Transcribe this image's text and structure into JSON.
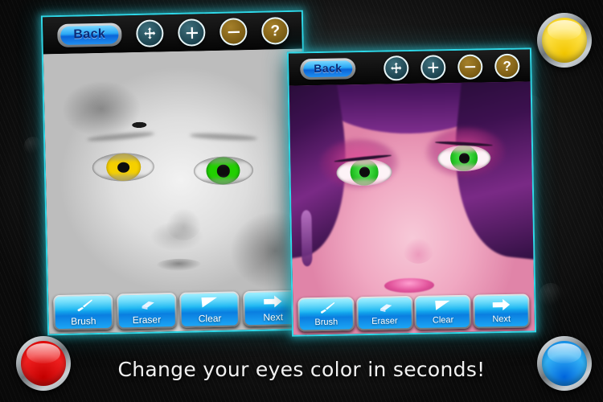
{
  "app": {
    "tagline": "Change your eyes color in seconds!"
  },
  "panels": [
    {
      "id": "baby",
      "subject": "grayscale baby photo with recolored eyes",
      "topbar": {
        "back_label": "Back",
        "icons": [
          {
            "name": "move-icon",
            "glyph": "move",
            "color": "#2a5a68"
          },
          {
            "name": "zoom-in-icon",
            "glyph": "plus",
            "color": "#2a5a68"
          },
          {
            "name": "zoom-out-icon",
            "glyph": "minus",
            "color": "#7b5c14"
          },
          {
            "name": "help-icon",
            "glyph": "?",
            "color": "#7b5c14"
          }
        ]
      },
      "eyes": {
        "left_color": "#f5d000",
        "right_color": "#22d000"
      },
      "toolbar": [
        {
          "name": "brush",
          "label": "Brush",
          "icon": "brush-icon"
        },
        {
          "name": "eraser",
          "label": "Eraser",
          "icon": "eraser-icon"
        },
        {
          "name": "clear",
          "label": "Clear",
          "icon": "clear-icon"
        },
        {
          "name": "next",
          "label": "Next",
          "icon": "arrow-right-icon"
        }
      ]
    },
    {
      "id": "woman",
      "subject": "pink toned portrait with green eyes",
      "topbar": {
        "back_label": "Back",
        "icons": [
          {
            "name": "move-icon",
            "glyph": "move",
            "color": "#2a5a68"
          },
          {
            "name": "zoom-in-icon",
            "glyph": "plus",
            "color": "#2a5a68"
          },
          {
            "name": "zoom-out-icon",
            "glyph": "minus",
            "color": "#7b5c14"
          },
          {
            "name": "help-icon",
            "glyph": "?",
            "color": "#7b5c14"
          }
        ]
      },
      "eyes": {
        "left_color": "#1fbf1f",
        "right_color": "#1fbf1f"
      },
      "toolbar": [
        {
          "name": "brush",
          "label": "Brush",
          "icon": "brush-icon"
        },
        {
          "name": "eraser",
          "label": "Eraser",
          "icon": "eraser-icon"
        },
        {
          "name": "clear",
          "label": "Clear",
          "icon": "clear-icon"
        },
        {
          "name": "next",
          "label": "Next",
          "icon": "arrow-right-icon"
        }
      ]
    }
  ],
  "corner_buttons": [
    {
      "name": "lamp-yellow",
      "color": "#ffd400",
      "position": "top-right"
    },
    {
      "name": "lamp-red",
      "color": "#e00000",
      "position": "bottom-left"
    },
    {
      "name": "lamp-blue",
      "color": "#0a84e8",
      "position": "bottom-right"
    }
  ],
  "theme": {
    "panel_border": "#2fd8e8",
    "button_blue": "#16b6f2",
    "background": "#141414"
  }
}
